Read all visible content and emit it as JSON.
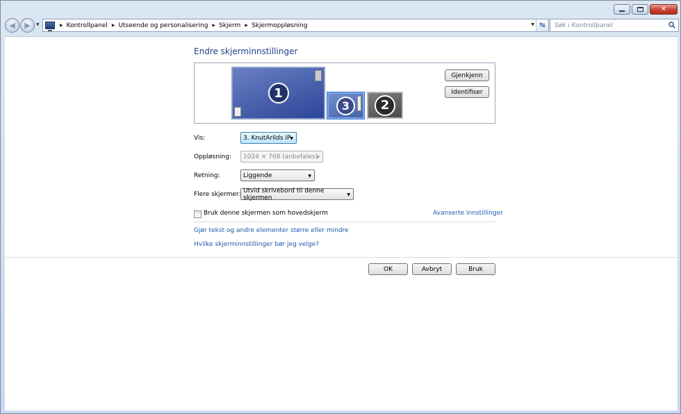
{
  "window": {
    "controls": {
      "minimize": "minimize",
      "maximize": "maximize",
      "close": "close"
    }
  },
  "address_bar": {
    "crumbs": [
      "Kontrollpanel",
      "Utseende og personalisering",
      "Skjerm",
      "Skjermoppløsning"
    ]
  },
  "search": {
    "placeholder": "Søk i Kontrollpanel"
  },
  "page": {
    "title": "Endre skjerminnstillinger",
    "monitors": [
      "1",
      "3",
      "2"
    ],
    "detect_button": "Gjenkjenn",
    "identify_button": "Identifiser"
  },
  "form": {
    "display_label": "Vis:",
    "display_value": "3. KnutArilds iP",
    "resolution_label": "Oppløsning:",
    "resolution_value": "1024 × 768 (anbefales)",
    "orientation_label": "Retning:",
    "orientation_value": "Liggende",
    "multiple_label": "Flere skjermer:",
    "multiple_value": "Utvid skrivebord til denne skjermen",
    "main_display_checkbox": "Bruk denne skjermen som hovedskjerm",
    "main_display_checked": false,
    "advanced_link": "Avanserte innstillinger"
  },
  "links": {
    "text_size": "Gjør tekst og andre elementer større eller mindre",
    "which_settings": "Hvilke skjerminnstillinger bør jeg velge?"
  },
  "footer": {
    "ok": "OK",
    "cancel": "Avbryt",
    "apply": "Bruk"
  }
}
